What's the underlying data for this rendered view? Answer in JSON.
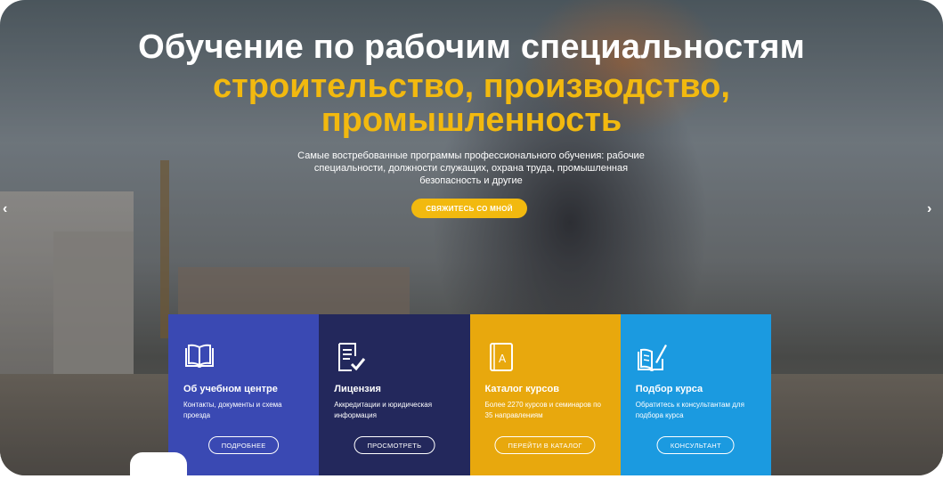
{
  "hero": {
    "title_line1": "Обучение по рабочим специальностям",
    "title_line2": "строительство, производство,",
    "title_line3": "промышленность",
    "subtitle": "Самые востребованные программы профессионального обучения: рабочие специальности, должности служащих, охрана труда, промышленная безопасность и другие",
    "cta_label": "СВЯЖИТЕСЬ СО МНОЙ",
    "accent_color": "#f2b90f"
  },
  "slider": {
    "prev_arrow": "‹",
    "next_arrow": "›"
  },
  "cards": [
    {
      "icon": "open-book-icon",
      "title": "Об учебном центре",
      "description": "Контакты, документы и схема проезда",
      "button": "ПОДРОБНЕЕ",
      "color": "#3a49b3"
    },
    {
      "icon": "document-check-icon",
      "title": "Лицензия",
      "description": "Аккредитации и юридическая информация",
      "button": "ПРОСМОТРЕТЬ",
      "color": "#23285c"
    },
    {
      "icon": "catalog-book-icon",
      "title": "Каталог курсов",
      "description": "Более 2270 курсов и семинаров по 35 направлениям",
      "button": "ПЕРЕЙТИ В КАТАЛОГ",
      "color": "#e8a80d"
    },
    {
      "icon": "notebook-pen-icon",
      "title": "Подбор курса",
      "description": "Обратитесь к консультантам для подбора курса",
      "button": "КОНСУЛЬТАНТ",
      "color": "#1b9ae0"
    }
  ]
}
